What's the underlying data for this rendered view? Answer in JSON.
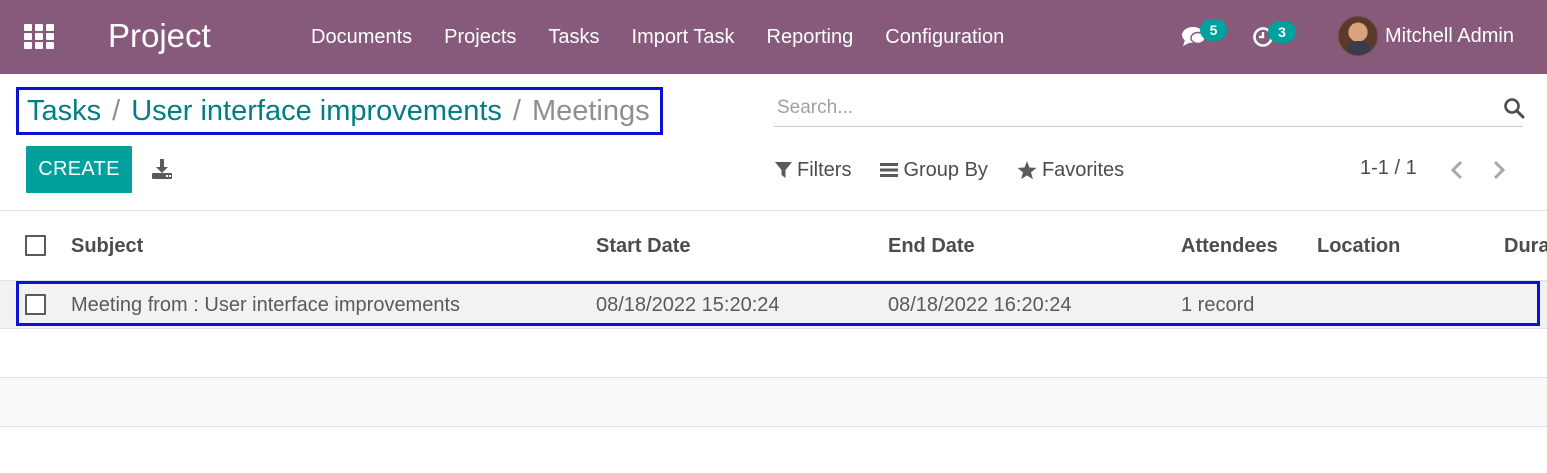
{
  "navbar": {
    "app_title": "Project",
    "menu": [
      "Documents",
      "Projects",
      "Tasks",
      "Import Task",
      "Reporting",
      "Configuration"
    ],
    "messages_count": "5",
    "activities_count": "3",
    "user_name": "Mitchell Admin"
  },
  "breadcrumb": {
    "items": [
      "Tasks",
      "User interface improvements"
    ],
    "separator": "/",
    "current": "Meetings"
  },
  "search": {
    "placeholder": "Search...",
    "value": ""
  },
  "toolbar": {
    "create_label": "CREATE",
    "filters_label": "Filters",
    "group_by_label": "Group By",
    "favorites_label": "Favorites"
  },
  "pager": {
    "value": "1-1 / 1"
  },
  "table": {
    "columns": [
      "Subject",
      "Start Date",
      "End Date",
      "Attendees",
      "Location",
      "Dura"
    ],
    "rows": [
      {
        "subject": "Meeting from : User interface improvements",
        "start_date": "08/18/2022 15:20:24",
        "end_date": "08/18/2022 16:20:24",
        "attendees": "1 record",
        "location": "",
        "duration": ""
      }
    ]
  },
  "colors": {
    "navbar": "#875a7b",
    "primary": "#00a09d",
    "link": "#017e84",
    "highlight_outline": "#0a12d6"
  }
}
